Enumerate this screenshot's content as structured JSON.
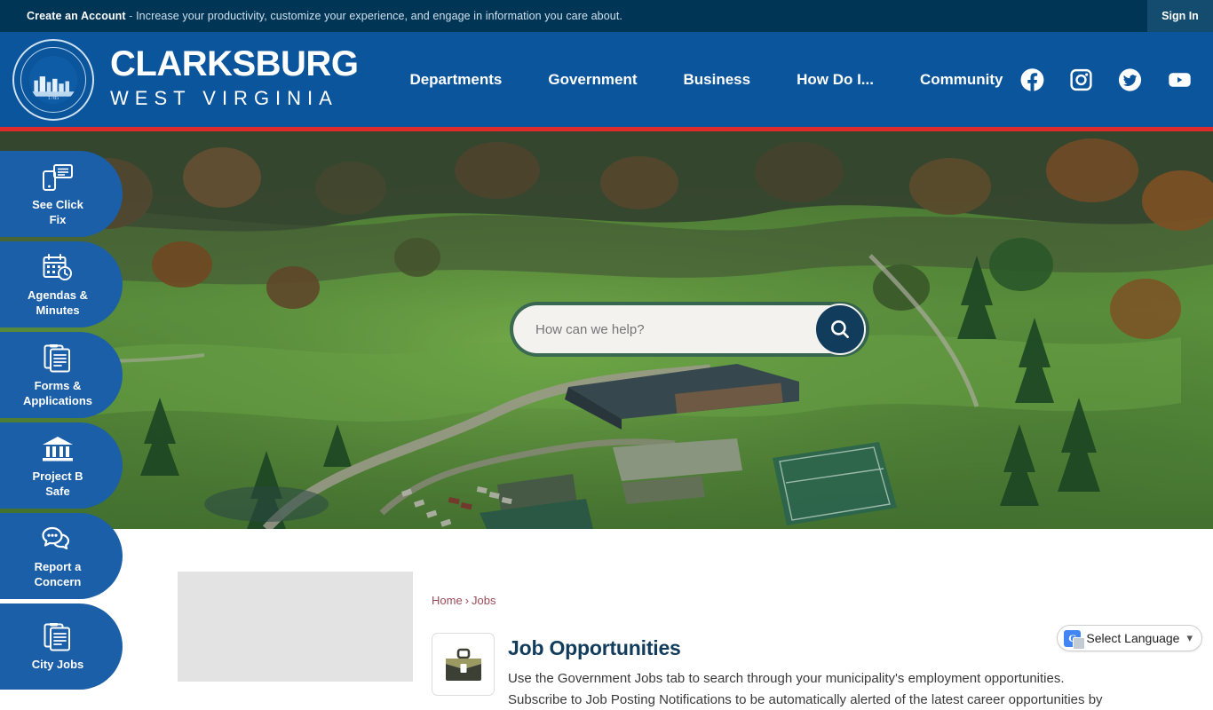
{
  "topbar": {
    "cta_label": "Create an Account",
    "dash": " - ",
    "message": "Increase your productivity, customize your experience, and engage in information you care about.",
    "signin_label": "Sign In"
  },
  "header": {
    "brand_title": "CLARKSBURG",
    "brand_subtitle": "WEST VIRGINIA",
    "seal_text": "SEAL OF THE CITY OF CLARKSBURG WEST VIRGINIA",
    "nav": [
      {
        "label": "Departments"
      },
      {
        "label": "Government"
      },
      {
        "label": "Business"
      },
      {
        "label": "How Do I..."
      },
      {
        "label": "Community"
      }
    ],
    "social": [
      {
        "name": "facebook-icon"
      },
      {
        "name": "instagram-icon"
      },
      {
        "name": "twitter-icon"
      },
      {
        "name": "youtube-icon"
      }
    ],
    "colors": {
      "topbar": "#003556",
      "header": "#0b559c",
      "accent_rule": "#e02b2b",
      "quicklink": "#1b5fa8",
      "heading": "#123c5c"
    }
  },
  "hero": {
    "search_placeholder": "How can we help?",
    "search_value": "",
    "search_button": "search-icon"
  },
  "quicklinks": [
    {
      "icon": "see-click-fix-icon",
      "label": "See Click\nFix"
    },
    {
      "icon": "calendar-clock-icon",
      "label": "Agendas &\nMinutes"
    },
    {
      "icon": "forms-icon",
      "label": "Forms &\nApplications"
    },
    {
      "icon": "bank-icon",
      "label": "Project B\nSafe"
    },
    {
      "icon": "chat-bubbles-icon",
      "label": "Report a\nConcern"
    },
    {
      "icon": "documents-icon",
      "label": "City Jobs"
    }
  ],
  "content": {
    "breadcrumb": {
      "home": "Home",
      "separator": "›",
      "current": "Jobs"
    },
    "page_icon": "briefcase-icon",
    "page_title": "Job Opportunities",
    "page_text_line1": "Use the Government Jobs tab to search through your municipality's employment opportunities.",
    "page_text_line2": "Subscribe to Job Posting Notifications to be automatically alerted of the latest career opportunities by"
  },
  "translate": {
    "icon": "google-translate-icon",
    "label": "Select Language",
    "chevron": "⌄"
  }
}
